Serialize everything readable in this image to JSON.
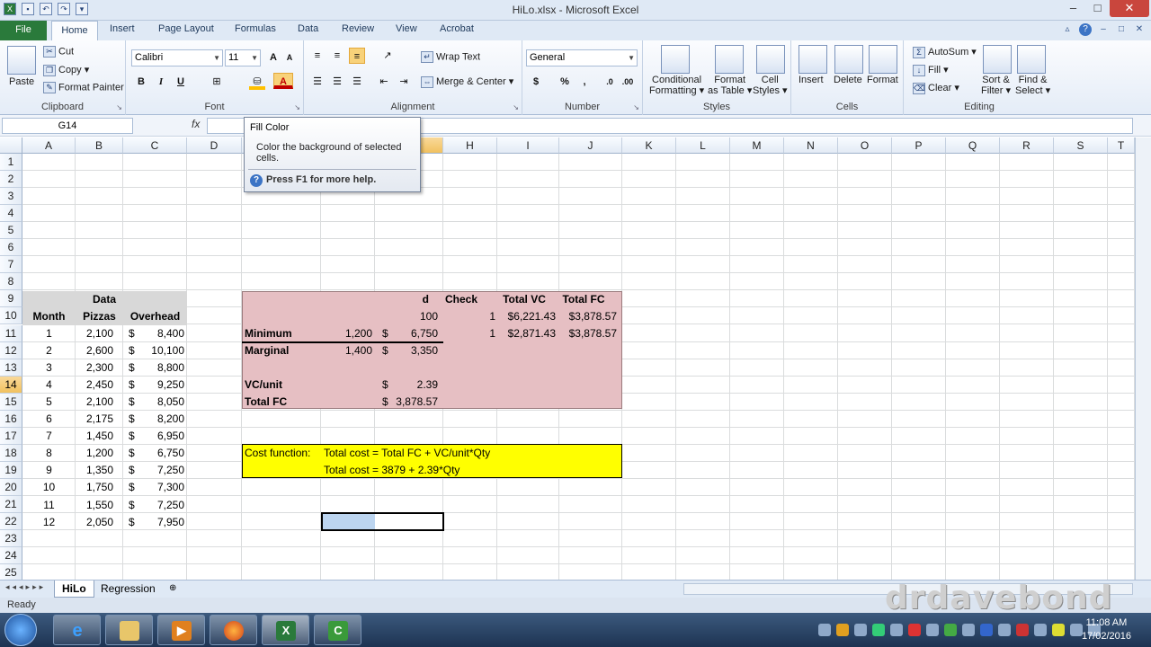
{
  "window": {
    "title": "HiLo.xlsx - Microsoft Excel",
    "controls": [
      "–",
      "□",
      "✕"
    ]
  },
  "ribbon_tabs": [
    "File",
    "Home",
    "Insert",
    "Page Layout",
    "Formulas",
    "Data",
    "Review",
    "View",
    "Acrobat"
  ],
  "clipboard": {
    "paste": "Paste",
    "cut": "Cut",
    "copy": "Copy",
    "format_painter": "Format Painter",
    "label": "Clipboard"
  },
  "font": {
    "name": "Calibri",
    "size": "11",
    "bold": "B",
    "italic": "I",
    "underline": "U",
    "label": "Font",
    "fill_color": "#ffc000",
    "font_color": "#c00000"
  },
  "alignment": {
    "wrap_text": "Wrap Text",
    "merge_center": "Merge & Center",
    "label": "Alignment"
  },
  "number": {
    "format": "General",
    "currency": "$",
    "percent": "%",
    "comma": ",",
    "label": "Number"
  },
  "styles": {
    "conditional": "Conditional",
    "conditional2": "Formatting",
    "format_as": "Format",
    "format_as2": "as Table",
    "cell": "Cell",
    "cell2": "Styles",
    "label": "Styles"
  },
  "cells": {
    "insert": "Insert",
    "delete": "Delete",
    "format": "Format",
    "label": "Cells"
  },
  "editing": {
    "autosum": "AutoSum",
    "fill": "Fill",
    "clear": "Clear",
    "sort": "Sort &",
    "sort2": "Filter",
    "find": "Find &",
    "find2": "Select",
    "label": "Editing"
  },
  "formula_bar": {
    "name_box": "G14",
    "fx": "fx",
    "value": ""
  },
  "tooltip": {
    "title": "Fill Color",
    "description": "Color the background of selected cells.",
    "help": "Press F1 for more help."
  },
  "columns": [
    "A",
    "B",
    "C",
    "D",
    "E",
    "F",
    "G",
    "H",
    "I",
    "J",
    "K",
    "L",
    "M",
    "N",
    "O",
    "P",
    "Q",
    "R",
    "S",
    "T"
  ],
  "rows": [
    "1",
    "2",
    "3",
    "4",
    "5",
    "6",
    "7",
    "8",
    "9",
    "10",
    "11",
    "12",
    "13",
    "14",
    "15",
    "16",
    "17",
    "18",
    "19",
    "20",
    "21",
    "22",
    "23",
    "24",
    "25"
  ],
  "table_left": {
    "header_data": "Data",
    "col_month": "Month",
    "col_pizzas": "Pizzas",
    "col_overhead": "Overhead",
    "rows": [
      {
        "month": "1",
        "pizzas": "2,100",
        "cur": "$",
        "overhead": "8,400"
      },
      {
        "month": "2",
        "pizzas": "2,600",
        "cur": "$",
        "overhead": "10,100"
      },
      {
        "month": "3",
        "pizzas": "2,300",
        "cur": "$",
        "overhead": "8,800"
      },
      {
        "month": "4",
        "pizzas": "2,450",
        "cur": "$",
        "overhead": "9,250"
      },
      {
        "month": "5",
        "pizzas": "2,100",
        "cur": "$",
        "overhead": "8,050"
      },
      {
        "month": "6",
        "pizzas": "2,175",
        "cur": "$",
        "overhead": "8,200"
      },
      {
        "month": "7",
        "pizzas": "1,450",
        "cur": "$",
        "overhead": "6,950"
      },
      {
        "month": "8",
        "pizzas": "1,200",
        "cur": "$",
        "overhead": "6,750"
      },
      {
        "month": "9",
        "pizzas": "1,350",
        "cur": "$",
        "overhead": "7,250"
      },
      {
        "month": "10",
        "pizzas": "1,750",
        "cur": "$",
        "overhead": "7,300"
      },
      {
        "month": "11",
        "pizzas": "1,550",
        "cur": "$",
        "overhead": "7,250"
      },
      {
        "month": "12",
        "pizzas": "2,050",
        "cur": "$",
        "overhead": "7,950"
      }
    ]
  },
  "hilo": {
    "g1_partial": "d",
    "g2_partial": "100",
    "minimum_label": "Minimum",
    "minimum_pizzas": "1,200",
    "minimum_cur": "$",
    "minimum_overhead": "6,750",
    "marginal_label": "Marginal",
    "marginal_pizzas": "1,400",
    "marginal_cur": "$",
    "marginal_overhead": "3,350",
    "vcunit_label": "VC/unit",
    "vcunit_cur": "$",
    "vcunit_value": "2.39",
    "totalfc_label": "Total FC",
    "totalfc_cur": "$",
    "totalfc_value": "3,878.57",
    "check_hdr": "Check",
    "totalvc_hdr": "Total VC",
    "totalfc_hdr": "Total FC",
    "check_r2": "1",
    "totalvc_r2": "$6,221.43",
    "totalfc_r2": "$3,878.57",
    "check_r3": "1",
    "totalvc_r3": "$2,871.43",
    "totalfc_r3": "$3,878.57"
  },
  "cost_function": {
    "label": "Cost function:",
    "line1": "Total cost = Total FC + VC/unit*Qty",
    "line2": "Total cost = 3879 + 2.39*Qty"
  },
  "sheets": [
    "HiLo",
    "Regression"
  ],
  "status": "Ready",
  "watermark": "drdavebond",
  "clock": {
    "time": "11:08 AM",
    "date": "17/02/2016"
  },
  "taskbar_apps": [
    "internet-explorer",
    "file-explorer",
    "media-player",
    "firefox",
    "excel",
    "camtasia"
  ]
}
